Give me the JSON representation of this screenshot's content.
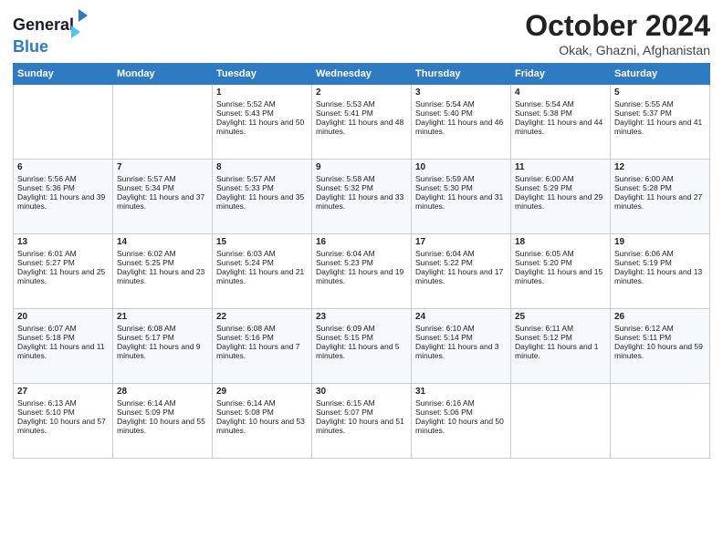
{
  "header": {
    "logo_line1": "General",
    "logo_line2": "Blue",
    "month": "October 2024",
    "location": "Okak, Ghazni, Afghanistan"
  },
  "weekdays": [
    "Sunday",
    "Monday",
    "Tuesday",
    "Wednesday",
    "Thursday",
    "Friday",
    "Saturday"
  ],
  "weeks": [
    [
      {
        "day": "",
        "info": ""
      },
      {
        "day": "",
        "info": ""
      },
      {
        "day": "1",
        "info": "Sunrise: 5:52 AM\nSunset: 5:43 PM\nDaylight: 11 hours and 50 minutes."
      },
      {
        "day": "2",
        "info": "Sunrise: 5:53 AM\nSunset: 5:41 PM\nDaylight: 11 hours and 48 minutes."
      },
      {
        "day": "3",
        "info": "Sunrise: 5:54 AM\nSunset: 5:40 PM\nDaylight: 11 hours and 46 minutes."
      },
      {
        "day": "4",
        "info": "Sunrise: 5:54 AM\nSunset: 5:38 PM\nDaylight: 11 hours and 44 minutes."
      },
      {
        "day": "5",
        "info": "Sunrise: 5:55 AM\nSunset: 5:37 PM\nDaylight: 11 hours and 41 minutes."
      }
    ],
    [
      {
        "day": "6",
        "info": "Sunrise: 5:56 AM\nSunset: 5:36 PM\nDaylight: 11 hours and 39 minutes."
      },
      {
        "day": "7",
        "info": "Sunrise: 5:57 AM\nSunset: 5:34 PM\nDaylight: 11 hours and 37 minutes."
      },
      {
        "day": "8",
        "info": "Sunrise: 5:57 AM\nSunset: 5:33 PM\nDaylight: 11 hours and 35 minutes."
      },
      {
        "day": "9",
        "info": "Sunrise: 5:58 AM\nSunset: 5:32 PM\nDaylight: 11 hours and 33 minutes."
      },
      {
        "day": "10",
        "info": "Sunrise: 5:59 AM\nSunset: 5:30 PM\nDaylight: 11 hours and 31 minutes."
      },
      {
        "day": "11",
        "info": "Sunrise: 6:00 AM\nSunset: 5:29 PM\nDaylight: 11 hours and 29 minutes."
      },
      {
        "day": "12",
        "info": "Sunrise: 6:00 AM\nSunset: 5:28 PM\nDaylight: 11 hours and 27 minutes."
      }
    ],
    [
      {
        "day": "13",
        "info": "Sunrise: 6:01 AM\nSunset: 5:27 PM\nDaylight: 11 hours and 25 minutes."
      },
      {
        "day": "14",
        "info": "Sunrise: 6:02 AM\nSunset: 5:25 PM\nDaylight: 11 hours and 23 minutes."
      },
      {
        "day": "15",
        "info": "Sunrise: 6:03 AM\nSunset: 5:24 PM\nDaylight: 11 hours and 21 minutes."
      },
      {
        "day": "16",
        "info": "Sunrise: 6:04 AM\nSunset: 5:23 PM\nDaylight: 11 hours and 19 minutes."
      },
      {
        "day": "17",
        "info": "Sunrise: 6:04 AM\nSunset: 5:22 PM\nDaylight: 11 hours and 17 minutes."
      },
      {
        "day": "18",
        "info": "Sunrise: 6:05 AM\nSunset: 5:20 PM\nDaylight: 11 hours and 15 minutes."
      },
      {
        "day": "19",
        "info": "Sunrise: 6:06 AM\nSunset: 5:19 PM\nDaylight: 11 hours and 13 minutes."
      }
    ],
    [
      {
        "day": "20",
        "info": "Sunrise: 6:07 AM\nSunset: 5:18 PM\nDaylight: 11 hours and 11 minutes."
      },
      {
        "day": "21",
        "info": "Sunrise: 6:08 AM\nSunset: 5:17 PM\nDaylight: 11 hours and 9 minutes."
      },
      {
        "day": "22",
        "info": "Sunrise: 6:08 AM\nSunset: 5:16 PM\nDaylight: 11 hours and 7 minutes."
      },
      {
        "day": "23",
        "info": "Sunrise: 6:09 AM\nSunset: 5:15 PM\nDaylight: 11 hours and 5 minutes."
      },
      {
        "day": "24",
        "info": "Sunrise: 6:10 AM\nSunset: 5:14 PM\nDaylight: 11 hours and 3 minutes."
      },
      {
        "day": "25",
        "info": "Sunrise: 6:11 AM\nSunset: 5:12 PM\nDaylight: 11 hours and 1 minute."
      },
      {
        "day": "26",
        "info": "Sunrise: 6:12 AM\nSunset: 5:11 PM\nDaylight: 10 hours and 59 minutes."
      }
    ],
    [
      {
        "day": "27",
        "info": "Sunrise: 6:13 AM\nSunset: 5:10 PM\nDaylight: 10 hours and 57 minutes."
      },
      {
        "day": "28",
        "info": "Sunrise: 6:14 AM\nSunset: 5:09 PM\nDaylight: 10 hours and 55 minutes."
      },
      {
        "day": "29",
        "info": "Sunrise: 6:14 AM\nSunset: 5:08 PM\nDaylight: 10 hours and 53 minutes."
      },
      {
        "day": "30",
        "info": "Sunrise: 6:15 AM\nSunset: 5:07 PM\nDaylight: 10 hours and 51 minutes."
      },
      {
        "day": "31",
        "info": "Sunrise: 6:16 AM\nSunset: 5:06 PM\nDaylight: 10 hours and 50 minutes."
      },
      {
        "day": "",
        "info": ""
      },
      {
        "day": "",
        "info": ""
      }
    ]
  ]
}
